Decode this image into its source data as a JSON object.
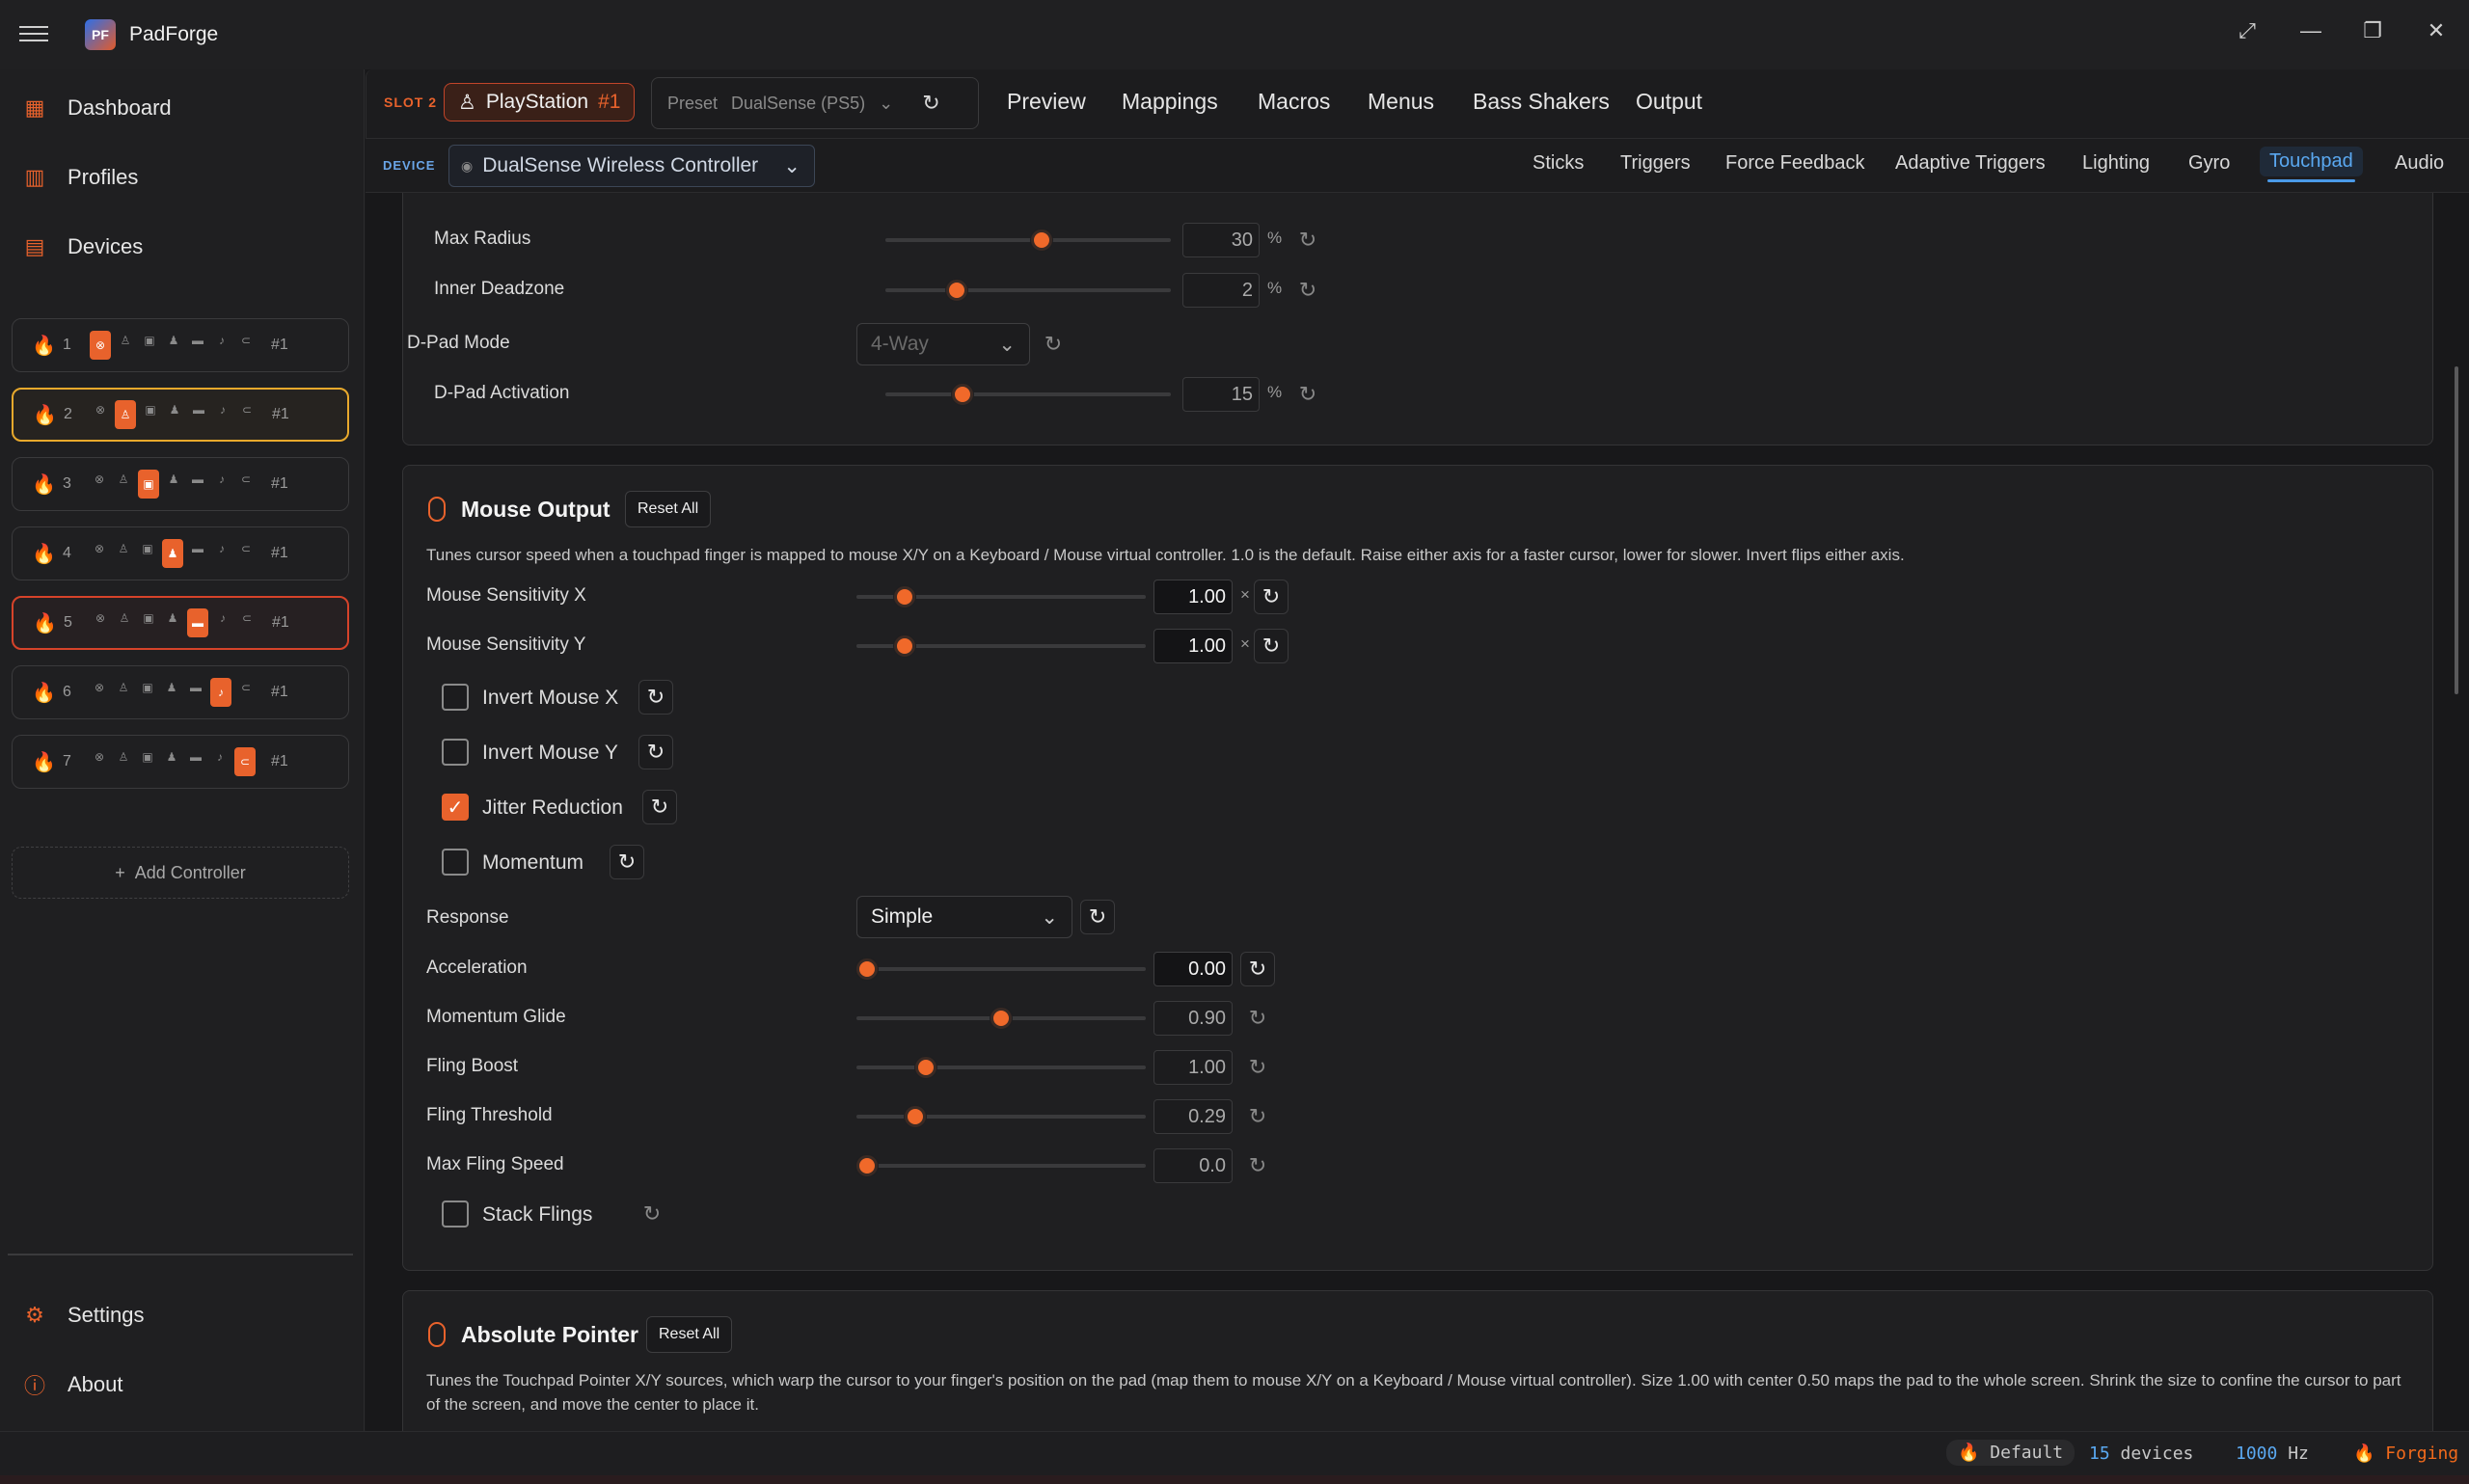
{
  "app": {
    "title": "PadForge",
    "logo_text": "PF"
  },
  "window_controls": {
    "expand": "⤢",
    "minimize": "—",
    "restore": "❐",
    "close": "✕"
  },
  "sidebar": {
    "nav": [
      {
        "label": "Dashboard",
        "icon": "dashboard-icon"
      },
      {
        "label": "Profiles",
        "icon": "profiles-icon"
      },
      {
        "label": "Devices",
        "icon": "devices-icon"
      }
    ],
    "slots": [
      {
        "num": "1",
        "tag": "#1",
        "active_index": 0,
        "flame_on": true
      },
      {
        "num": "2",
        "tag": "#1",
        "active_index": 1,
        "flame_on": true
      },
      {
        "num": "3",
        "tag": "#1",
        "active_index": 2,
        "flame_on": false
      },
      {
        "num": "4",
        "tag": "#1",
        "active_index": 3,
        "flame_on": true
      },
      {
        "num": "5",
        "tag": "#1",
        "active_index": 4,
        "flame_on": true
      },
      {
        "num": "6",
        "tag": "#1",
        "active_index": 5,
        "flame_on": false
      },
      {
        "num": "7",
        "tag": "#1",
        "active_index": 6,
        "flame_on": false
      }
    ],
    "add_controller": "Add Controller",
    "footer": [
      {
        "label": "Settings",
        "icon": "gear-icon"
      },
      {
        "label": "About",
        "icon": "info-icon"
      }
    ]
  },
  "topbar": {
    "slot_label": "SLOT 2",
    "controller_name": "PlayStation",
    "controller_num": "#1",
    "preset_label": "Preset",
    "preset_value": "DualSense (PS5)",
    "tabs": [
      "Preview",
      "Mappings",
      "Macros",
      "Menus",
      "Bass Shakers",
      "Output"
    ]
  },
  "devicebar": {
    "label": "DEVICE",
    "device_name": "DualSense Wireless Controller",
    "tabs": [
      "Sticks",
      "Triggers",
      "Force Feedback",
      "Adaptive Triggers",
      "Lighting",
      "Gyro",
      "Touchpad",
      "Audio"
    ],
    "active_tab": "Touchpad"
  },
  "upper_section": {
    "max_radius": {
      "label": "Max Radius",
      "value": "30",
      "unit": "%",
      "fraction": 0.55
    },
    "inner_deadzone": {
      "label": "Inner Deadzone",
      "value": "2",
      "unit": "%",
      "fraction": 0.23
    },
    "dpad_mode": {
      "label": "D-Pad Mode",
      "value": "4-Way"
    },
    "dpad_activation": {
      "label": "D-Pad Activation",
      "value": "15",
      "unit": "%",
      "fraction": 0.25
    }
  },
  "mouse_output": {
    "title": "Mouse Output",
    "reset_all": "Reset All",
    "description": "Tunes cursor speed when a touchpad finger is mapped to mouse X/Y on a Keyboard / Mouse virtual controller. 1.0 is the default. Raise either axis for a faster cursor, lower for slower. Invert flips either axis.",
    "sens_x": {
      "label": "Mouse Sensitivity X",
      "value": "1.00",
      "unit": "×",
      "fraction": 0.14
    },
    "sens_y": {
      "label": "Mouse Sensitivity Y",
      "value": "1.00",
      "unit": "×",
      "fraction": 0.14
    },
    "checks": [
      {
        "label": "Invert Mouse X",
        "checked": false
      },
      {
        "label": "Invert Mouse Y",
        "checked": false
      },
      {
        "label": "Jitter Reduction",
        "checked": true
      },
      {
        "label": "Momentum",
        "checked": false
      }
    ],
    "response": {
      "label": "Response",
      "value": "Simple"
    },
    "acceleration": {
      "label": "Acceleration",
      "value": "0.00",
      "fraction": 0.0
    },
    "momentum_glide": {
      "label": "Momentum Glide",
      "value": "0.90",
      "fraction": 0.5
    },
    "fling_boost": {
      "label": "Fling Boost",
      "value": "1.00",
      "fraction": 0.22
    },
    "fling_threshold": {
      "label": "Fling Threshold",
      "value": "0.29",
      "fraction": 0.18
    },
    "max_fling_speed": {
      "label": "Max Fling Speed",
      "value": "0.0",
      "fraction": 0.0
    },
    "stack_flings": {
      "label": "Stack Flings",
      "checked": false
    }
  },
  "absolute_pointer": {
    "title": "Absolute Pointer",
    "reset_all": "Reset All",
    "description": "Tunes the Touchpad Pointer X/Y sources, which warp the cursor to your finger's position on the pad (map them to mouse X/Y on a Keyboard / Mouse virtual controller). Size 1.00 with center 0.50 maps the pad to the whole screen. Shrink the size to confine the cursor to part of the screen, and move the center to place it."
  },
  "statusbar": {
    "profile": "Default",
    "devices_count": "15",
    "devices_label": "devices",
    "rate": "1000",
    "rate_unit": "Hz",
    "engine": "Forging"
  },
  "colors": {
    "accent": "#e8622c",
    "active_tab": "#5aa8f0",
    "slot2_border": "#e8a92c",
    "slot5_border": "#d6432a"
  }
}
